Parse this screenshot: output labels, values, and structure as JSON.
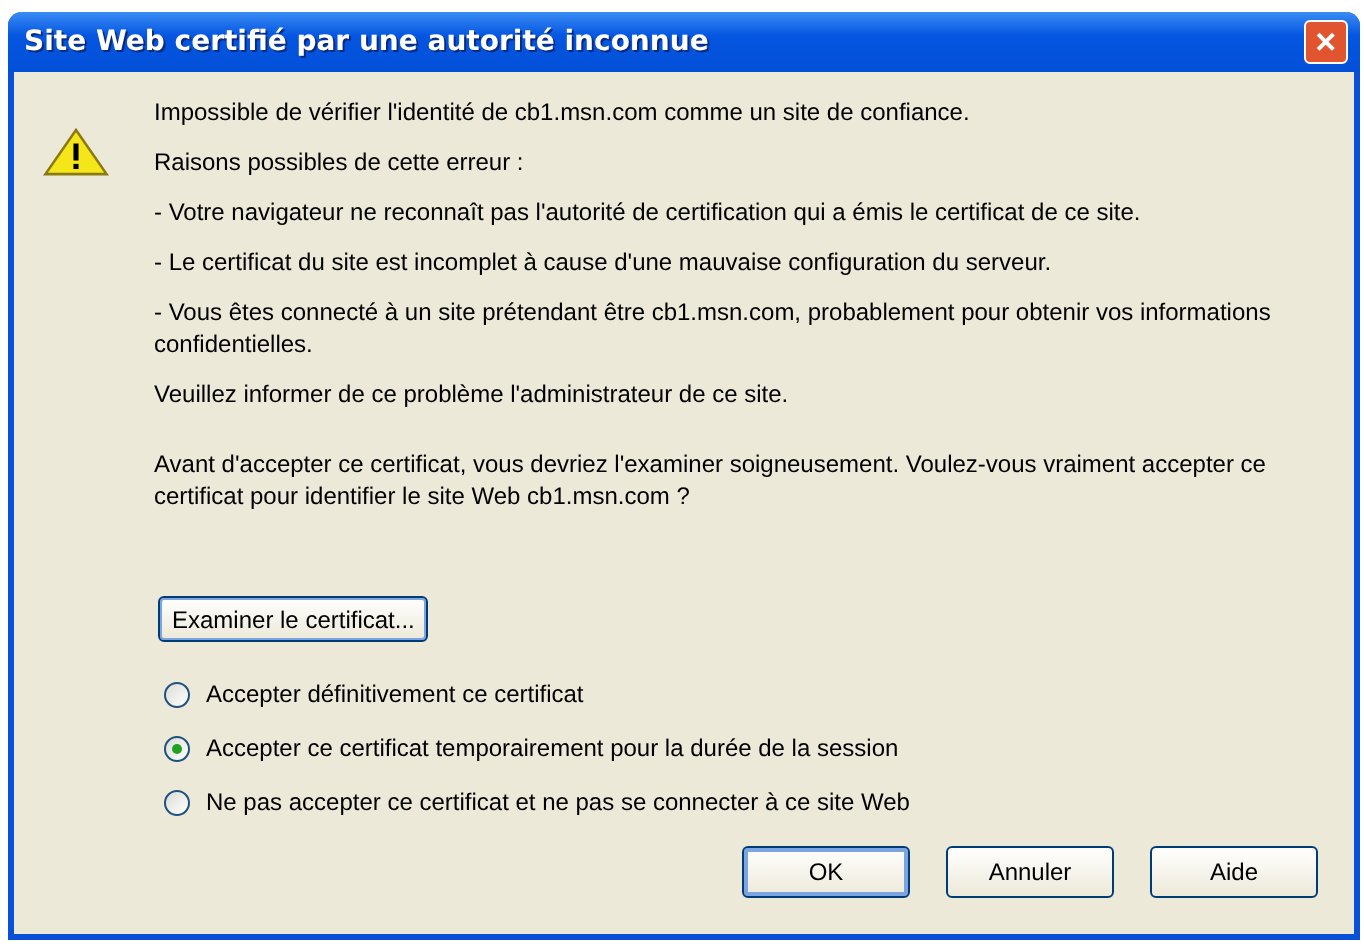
{
  "window": {
    "title": "Site Web certifié par une autorité inconnue",
    "close_glyph": "✕"
  },
  "message": "Impossible de vérifier l'identité de cb1.msn.com comme un site de confiance.",
  "reasons_heading": "Raisons possibles de cette erreur :",
  "reasons": [
    "- Votre navigateur ne reconnaît pas l'autorité de certification qui a émis le certificat de ce site.",
    "- Le certificat du site est incomplet à cause d'une mauvaise configuration du serveur.",
    "- Vous êtes connecté à un site prétendant être cb1.msn.com, probablement pour obtenir vos informations confidentielles."
  ],
  "inform": "Veuillez informer de ce problème l'administrateur de ce site.",
  "advice": "Avant d'accepter ce certificat, vous devriez l'examiner soigneusement. Voulez-vous vraiment accepter ce certificat pour identifier le site Web cb1.msn.com ?",
  "examine_button": "Examiner le certificat...",
  "options": [
    {
      "label": "Accepter définitivement ce certificat",
      "selected": false
    },
    {
      "label": "Accepter ce certificat temporairement pour la durée de la session",
      "selected": true
    },
    {
      "label": "Ne pas accepter ce certificat et ne pas se connecter à ce site Web",
      "selected": false
    }
  ],
  "buttons": [
    {
      "label": "OK",
      "default": true
    },
    {
      "label": "Annuler",
      "default": false
    },
    {
      "label": "Aide",
      "default": false
    }
  ]
}
